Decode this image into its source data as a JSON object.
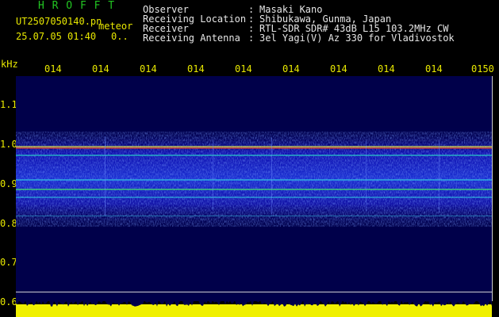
{
  "header": {
    "title": "H R O F F T",
    "filename": "UT2507050140.pn",
    "filename_suffix": "meteor",
    "datetime": "25.07.05 01:40",
    "count": "0..",
    "fields": [
      {
        "label": "Observer",
        "value": "Masaki Kano"
      },
      {
        "label": "Receiving Location",
        "value": "Shibukawa, Gunma, Japan"
      },
      {
        "label": "Receiver",
        "value": "RTL-SDR SDR# 43dB L15 103.2MHz CW"
      },
      {
        "label": "Receiving Antenna",
        "value": "3el Yagi(V) Az 330 for Vladivostok"
      }
    ]
  },
  "time_ticks": [
    "014",
    "014",
    "014",
    "014",
    "014",
    "014",
    "014",
    "014",
    "014",
    "0150"
  ],
  "freq_axis": {
    "unit": "kHz",
    "ticks": [
      "1.1",
      "1.0",
      "0.9",
      "0.8",
      "0.7",
      "0.6"
    ]
  },
  "colors": {
    "background": "#000000",
    "spectrogram_bg": "#00004a",
    "text_yellow": "#e8e800",
    "text_white": "#e6e6e6",
    "title_green": "#22c522"
  }
}
